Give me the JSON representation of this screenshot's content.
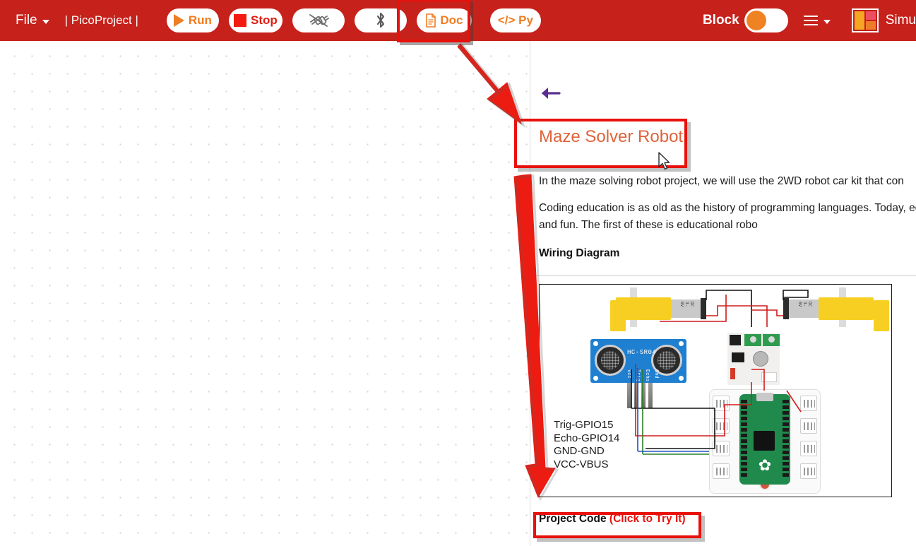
{
  "header": {
    "file_menu": "File",
    "project_name": "| PicoProject |",
    "run_label": "Run",
    "stop_label": "Stop",
    "doc_label": "Doc",
    "py_label": "</> Py",
    "block_label": "Block",
    "simulator_label": "Simu",
    "icons": {
      "connect": "usb-disconnected-icon",
      "bluetooth": "bluetooth-icon",
      "doc": "document-icon",
      "menu": "hamburger-menu-icon",
      "layout": "layout-panels-icon"
    }
  },
  "document": {
    "back_arrow": "back-arrow",
    "title": "Maze Solver Robot",
    "paragraph1": "In the maze solving robot project, we will use the 2WD robot car kit that con",
    "paragraph2": "Coding education is as old as the history of programming languages. Today, education and make it exciting and fun. The first of these is educational robo",
    "subheading": "Wiring Diagram",
    "project_code_label": "Project Code",
    "project_code_hint": "(Click to Try It)"
  },
  "wiring_diagram": {
    "pin_mapping": [
      "Trig-GPIO15",
      "Echo-GPIO14",
      "GND-GND",
      "VCC-VBUS"
    ],
    "sensor_name": "HC-SR04",
    "sensor_pins": [
      "Vcc",
      "Trig",
      "Echo",
      "Gnd"
    ],
    "motor_label": "DC 3-6V",
    "board_name": "Raspberry Pi Pico"
  },
  "annotations": {
    "doc_button_highlight": "red-box-around-doc-button",
    "title_highlight": "red-box-around-title",
    "code_highlight": "red-box-around-project-code",
    "arrow1": "arrow-from-doc-button-to-title",
    "arrow2": "arrow-from-title-to-project-code"
  },
  "colors": {
    "header_red": "#c6211b",
    "accent_orange": "#f07d22",
    "annotation_red": "#e8110b",
    "title_orange": "#e0633b",
    "back_arrow_purple": "#5b2d90"
  }
}
